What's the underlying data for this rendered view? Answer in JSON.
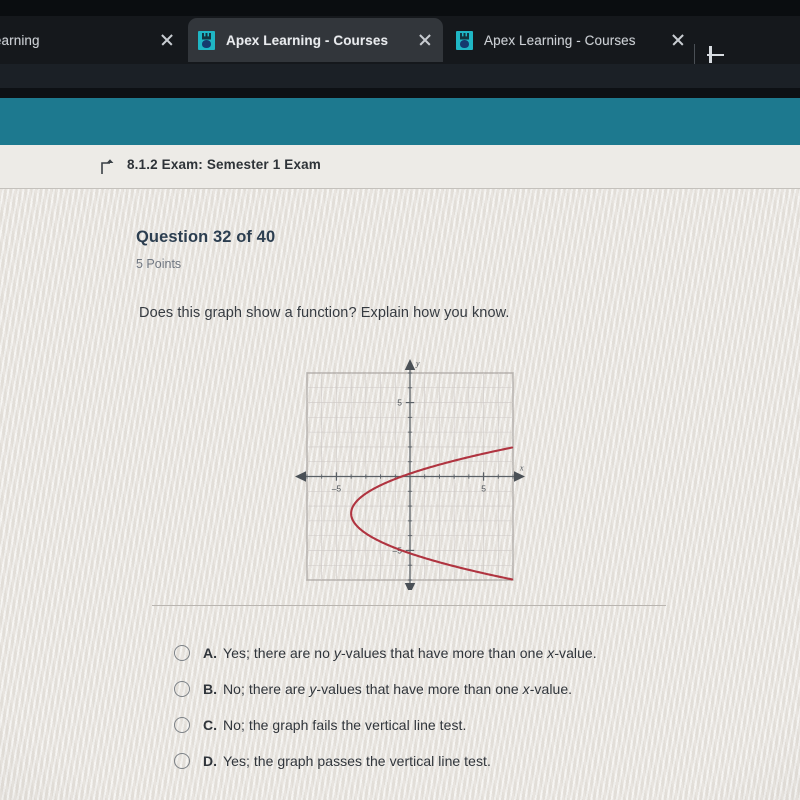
{
  "browser": {
    "tabs": [
      {
        "title": "ex Learning",
        "favicon": "apex-favicon",
        "active": false,
        "close_label": "×"
      },
      {
        "title": "Apex Learning - Courses",
        "favicon": "apex-favicon",
        "active": true,
        "close_label": "×"
      },
      {
        "title": "Apex Learning - Courses",
        "favicon": "apex-favicon",
        "active": false,
        "close_label": "×"
      }
    ],
    "new_tab_label": "+"
  },
  "header": {
    "banner_color": "#1d798f",
    "breadcrumb_icon": "up-level-arrow-icon",
    "breadcrumb": "8.1.2  Exam:  Semester 1 Exam"
  },
  "question": {
    "title": "Question 32 of 40",
    "points": "5 Points",
    "prompt": "Does this graph show a function? Explain how you know."
  },
  "options": [
    {
      "letter": "A.",
      "text_html": "Yes; there are no <i>y</i>-values that have more than one <i>x</i>-value.",
      "selected": false
    },
    {
      "letter": "B.",
      "text_html": "No; there are <i>y</i>-values that have more than one <i>x</i>-value.",
      "selected": false
    },
    {
      "letter": "C.",
      "text_html": "No; the graph fails the vertical line test.",
      "selected": false
    },
    {
      "letter": "D.",
      "text_html": "Yes; the graph passes the vertical line test.",
      "selected": false
    }
  ],
  "chart_data": {
    "type": "line",
    "title": "",
    "xlabel": "x",
    "ylabel": "y",
    "xlim": [
      -7,
      7
    ],
    "ylim": [
      -7,
      7
    ],
    "xticks": [
      -5,
      5
    ],
    "yticks": [
      5,
      -5
    ],
    "xtick_labels": [
      "–5",
      "5"
    ],
    "ytick_labels": [
      "5",
      "–5"
    ],
    "grid": true,
    "axis_arrows": true,
    "curve_color": "#b03440",
    "description": "Sideways parabola opening to the right, vertex at approximately (-4, -2.5); fails the vertical line test.",
    "series": [
      {
        "name": "sideways-parabola",
        "equation": "x = 0.55*(y + 2.5)^2 - 4",
        "points": [
          [
            6.5,
            1.9
          ],
          [
            4.0,
            1.3
          ],
          [
            2.0,
            0.8
          ],
          [
            0.5,
            0.45
          ],
          [
            -1.0,
            0.0
          ],
          [
            -2.0,
            -0.6
          ],
          [
            -3.0,
            -1.2
          ],
          [
            -3.6,
            -1.7
          ],
          [
            -3.95,
            -2.2
          ],
          [
            -4.0,
            -2.5
          ],
          [
            -3.9,
            -2.9
          ],
          [
            -3.5,
            -3.4
          ],
          [
            -2.8,
            -4.0
          ],
          [
            -1.6,
            -4.7
          ],
          [
            0.0,
            -5.3
          ],
          [
            2.0,
            -5.9
          ],
          [
            4.0,
            -6.3
          ],
          [
            6.5,
            -6.8
          ]
        ]
      }
    ]
  }
}
